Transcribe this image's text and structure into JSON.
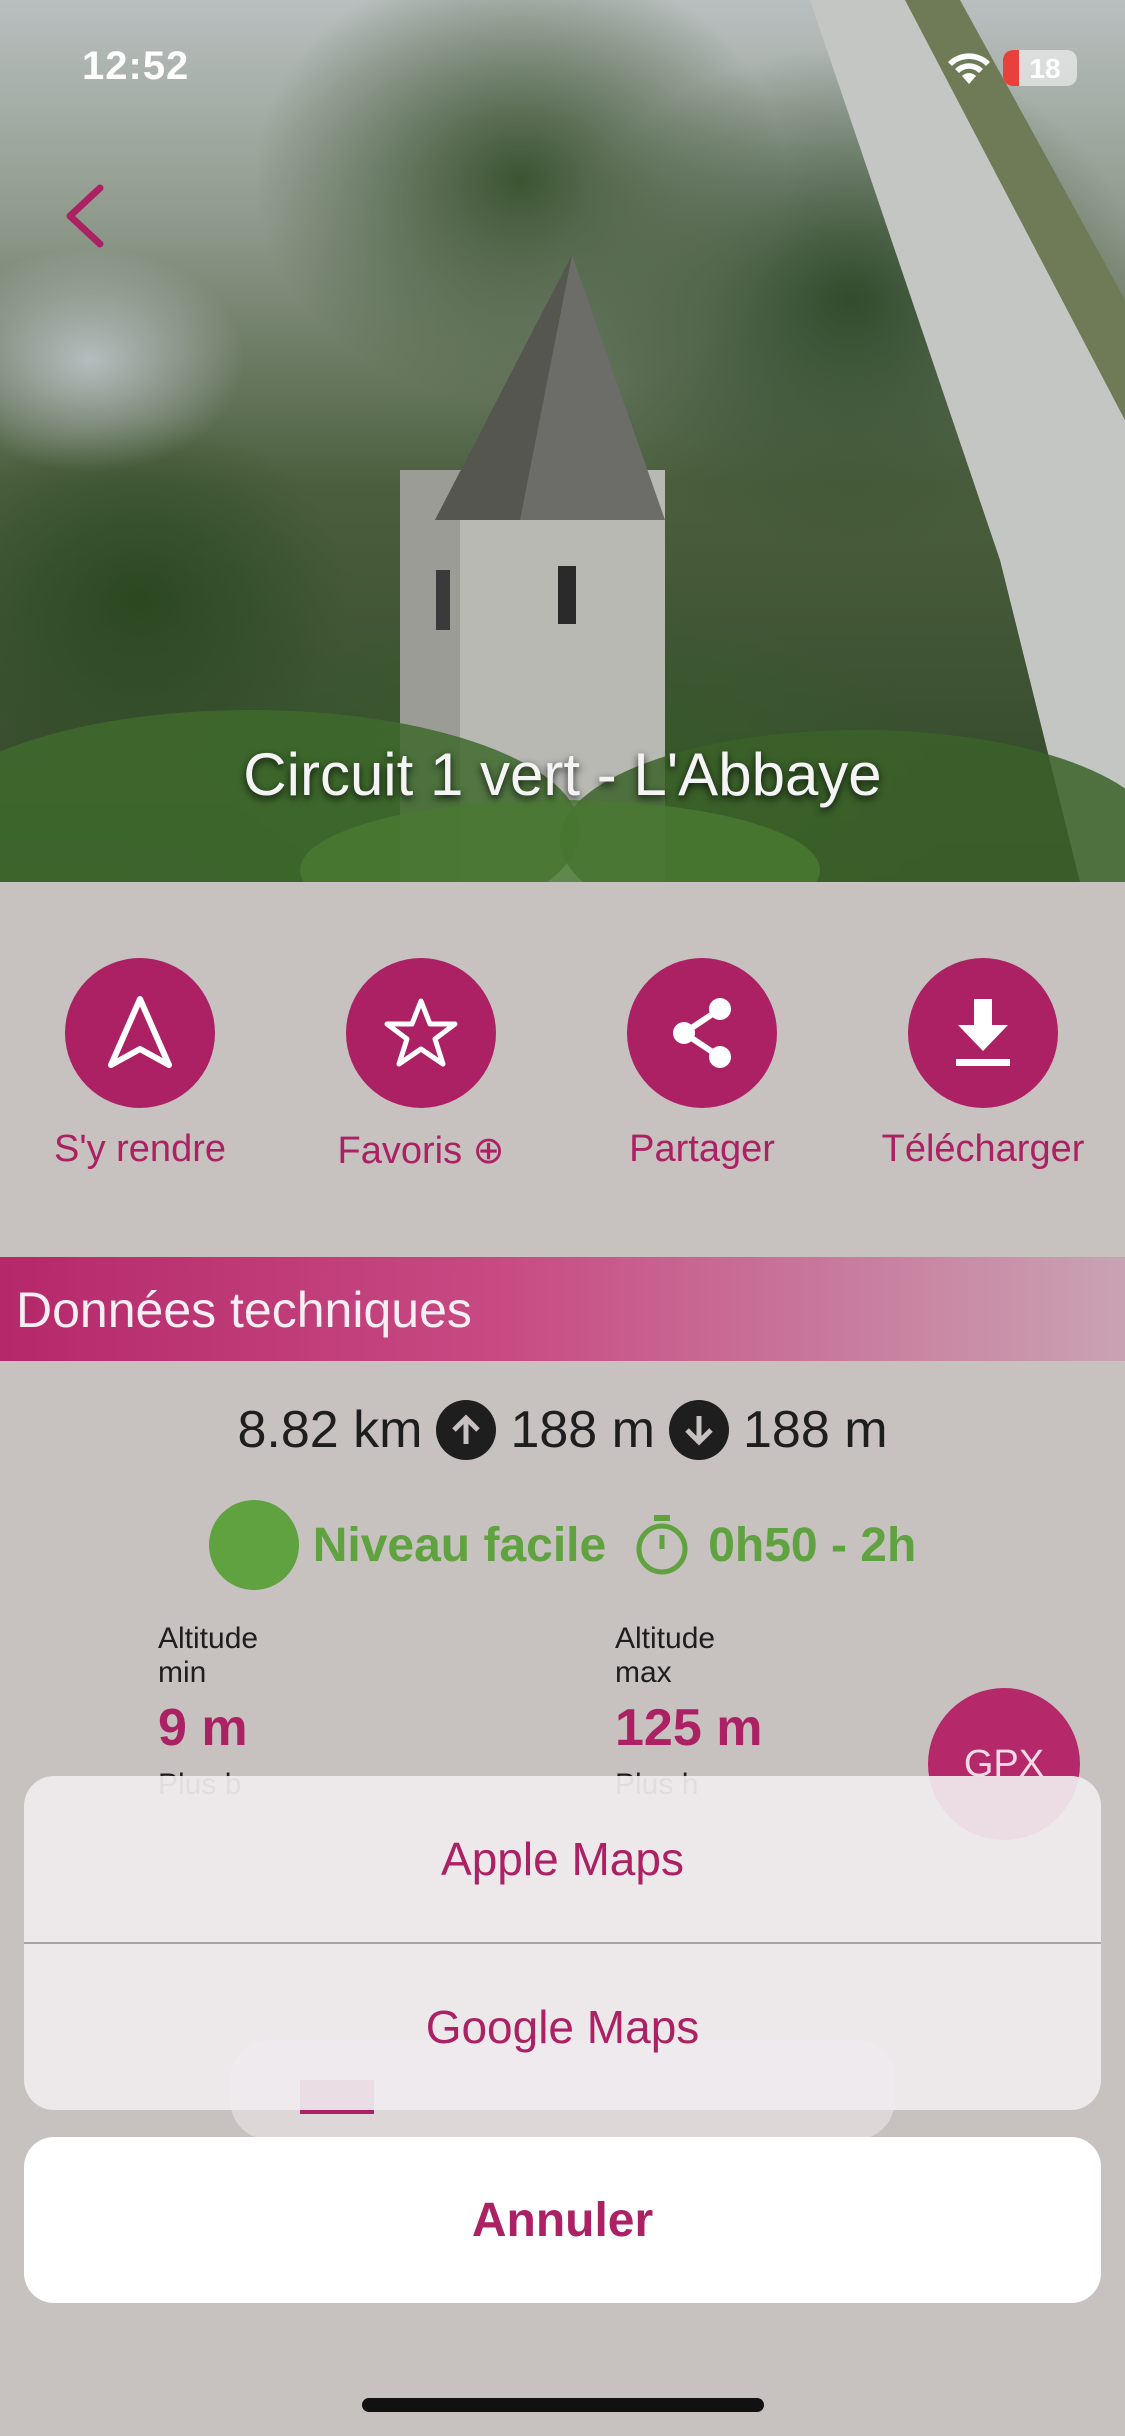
{
  "status_bar": {
    "time": "12:52",
    "battery": "18"
  },
  "hero": {
    "title": "Circuit 1 vert - L'Abbaye"
  },
  "actions": [
    {
      "label": "S'y rendre",
      "icon": "navigation-arrow-icon"
    },
    {
      "label": "Favoris ⊕",
      "icon": "star-icon"
    },
    {
      "label": "Partager",
      "icon": "share-icon"
    },
    {
      "label": "Télécharger",
      "icon": "download-icon"
    }
  ],
  "section": {
    "title": "Données techniques"
  },
  "stats": {
    "distance": "8.82 km",
    "ascent": "188 m",
    "descent": "188 m",
    "level": "Niveau facile",
    "duration": "0h50 - 2h",
    "altitude_min_label": "Altitude min",
    "altitude_min_value": "9 m",
    "altitude_max_label": "Altitude max",
    "altitude_max_value": "125 m",
    "hidden_label_1": "Plus b",
    "hidden_label_2": "Plus h",
    "gpx_label": "GPX"
  },
  "sheet": {
    "options": [
      "Apple Maps",
      "Google Maps"
    ],
    "cancel": "Annuler"
  },
  "colors": {
    "accent": "#ab2163",
    "level_green": "#5fa23f",
    "background": "#c7c1c0"
  }
}
